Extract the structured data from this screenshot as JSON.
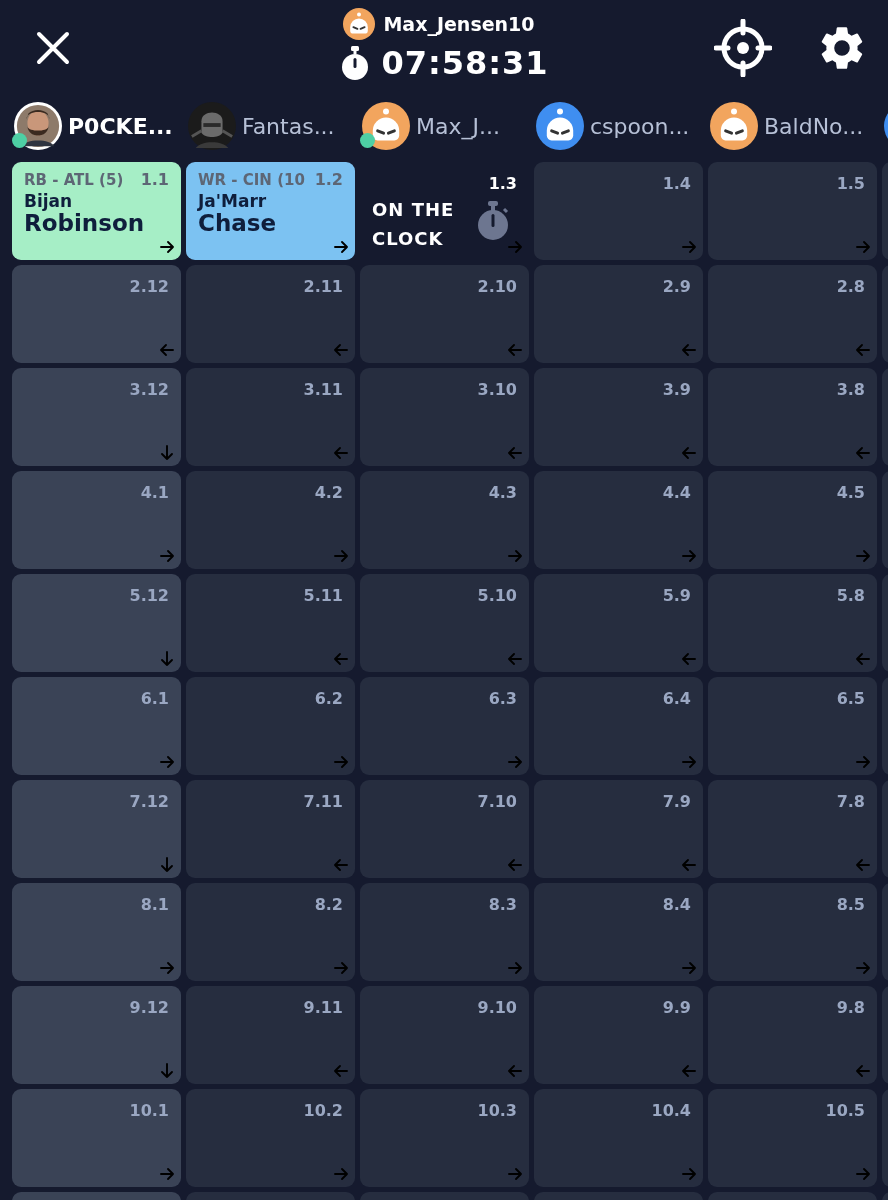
{
  "header": {
    "user": {
      "name": "Max_Jensen10",
      "avatar": {
        "kind": "bot",
        "color": "#f2a55e"
      }
    },
    "timer": "07:58:31"
  },
  "teams": [
    {
      "name": "P0CKE...",
      "selected": true,
      "online": true
    },
    {
      "name": "Fantas...",
      "selected": false,
      "online": false,
      "avatar": {
        "kind": "photo-dark"
      }
    },
    {
      "name": "Max_J...",
      "selected": false,
      "online": true,
      "avatar": {
        "kind": "bot",
        "color": "#f2a55e"
      }
    },
    {
      "name": "cspoon...",
      "selected": false,
      "online": false,
      "avatar": {
        "kind": "bot",
        "color": "#3f8ef0"
      }
    },
    {
      "name": "BaldNo...",
      "selected": false,
      "online": false,
      "avatar": {
        "kind": "bot",
        "color": "#f2a55e"
      }
    }
  ],
  "rounds": [
    {
      "cells": [
        {
          "kind": "player",
          "pick": "1.1",
          "arrow": {
            "kind": "right"
          },
          "position": "RB - ATL (5)",
          "first": "Bijan",
          "last": "Robinson",
          "color": "#a6eec6"
        },
        {
          "kind": "player",
          "pick": "1.2",
          "arrow": {
            "kind": "right"
          },
          "position": "WR - CIN (10",
          "first": "Ja'Marr",
          "last": "Chase",
          "color": "#7cc2f2"
        },
        {
          "kind": "on_clock",
          "pick": "1.3",
          "arrow": {
            "kind": "right"
          },
          "label": "ON THE CLOCK"
        },
        {
          "kind": "empty",
          "pick": "1.4",
          "arrow": {
            "kind": "right"
          }
        },
        {
          "kind": "empty",
          "pick": "1.5",
          "arrow": {
            "kind": "right"
          }
        }
      ]
    },
    {
      "cells": [
        {
          "kind": "empty",
          "pick": "2.12",
          "arrow": {
            "kind": "left"
          }
        },
        {
          "kind": "empty",
          "pick": "2.11",
          "arrow": {
            "kind": "left"
          }
        },
        {
          "kind": "empty",
          "pick": "2.10",
          "arrow": {
            "kind": "left"
          }
        },
        {
          "kind": "empty",
          "pick": "2.9",
          "arrow": {
            "kind": "left"
          }
        },
        {
          "kind": "empty",
          "pick": "2.8",
          "arrow": {
            "kind": "left"
          }
        }
      ]
    },
    {
      "cells": [
        {
          "kind": "empty",
          "pick": "3.12",
          "arrow": {
            "kind": "down"
          }
        },
        {
          "kind": "empty",
          "pick": "3.11",
          "arrow": {
            "kind": "left"
          }
        },
        {
          "kind": "empty",
          "pick": "3.10",
          "arrow": {
            "kind": "left"
          }
        },
        {
          "kind": "empty",
          "pick": "3.9",
          "arrow": {
            "kind": "left"
          }
        },
        {
          "kind": "empty",
          "pick": "3.8",
          "arrow": {
            "kind": "left"
          }
        }
      ]
    },
    {
      "cells": [
        {
          "kind": "empty",
          "pick": "4.1",
          "arrow": {
            "kind": "right"
          }
        },
        {
          "kind": "empty",
          "pick": "4.2",
          "arrow": {
            "kind": "right"
          }
        },
        {
          "kind": "empty",
          "pick": "4.3",
          "arrow": {
            "kind": "right"
          }
        },
        {
          "kind": "empty",
          "pick": "4.4",
          "arrow": {
            "kind": "right"
          }
        },
        {
          "kind": "empty",
          "pick": "4.5",
          "arrow": {
            "kind": "right"
          }
        }
      ]
    },
    {
      "cells": [
        {
          "kind": "empty",
          "pick": "5.12",
          "arrow": {
            "kind": "down"
          }
        },
        {
          "kind": "empty",
          "pick": "5.11",
          "arrow": {
            "kind": "left"
          }
        },
        {
          "kind": "empty",
          "pick": "5.10",
          "arrow": {
            "kind": "left"
          }
        },
        {
          "kind": "empty",
          "pick": "5.9",
          "arrow": {
            "kind": "left"
          }
        },
        {
          "kind": "empty",
          "pick": "5.8",
          "arrow": {
            "kind": "left"
          }
        }
      ]
    },
    {
      "cells": [
        {
          "kind": "empty",
          "pick": "6.1",
          "arrow": {
            "kind": "right"
          }
        },
        {
          "kind": "empty",
          "pick": "6.2",
          "arrow": {
            "kind": "right"
          }
        },
        {
          "kind": "empty",
          "pick": "6.3",
          "arrow": {
            "kind": "right"
          }
        },
        {
          "kind": "empty",
          "pick": "6.4",
          "arrow": {
            "kind": "right"
          }
        },
        {
          "kind": "empty",
          "pick": "6.5",
          "arrow": {
            "kind": "right"
          }
        }
      ]
    },
    {
      "cells": [
        {
          "kind": "empty",
          "pick": "7.12",
          "arrow": {
            "kind": "down"
          }
        },
        {
          "kind": "empty",
          "pick": "7.11",
          "arrow": {
            "kind": "left"
          }
        },
        {
          "kind": "empty",
          "pick": "7.10",
          "arrow": {
            "kind": "left"
          }
        },
        {
          "kind": "empty",
          "pick": "7.9",
          "arrow": {
            "kind": "left"
          }
        },
        {
          "kind": "empty",
          "pick": "7.8",
          "arrow": {
            "kind": "left"
          }
        }
      ]
    },
    {
      "cells": [
        {
          "kind": "empty",
          "pick": "8.1",
          "arrow": {
            "kind": "right"
          }
        },
        {
          "kind": "empty",
          "pick": "8.2",
          "arrow": {
            "kind": "right"
          }
        },
        {
          "kind": "empty",
          "pick": "8.3",
          "arrow": {
            "kind": "right"
          }
        },
        {
          "kind": "empty",
          "pick": "8.4",
          "arrow": {
            "kind": "right"
          }
        },
        {
          "kind": "empty",
          "pick": "8.5",
          "arrow": {
            "kind": "right"
          }
        }
      ]
    },
    {
      "cells": [
        {
          "kind": "empty",
          "pick": "9.12",
          "arrow": {
            "kind": "down"
          }
        },
        {
          "kind": "empty",
          "pick": "9.11",
          "arrow": {
            "kind": "left"
          }
        },
        {
          "kind": "empty",
          "pick": "9.10",
          "arrow": {
            "kind": "left"
          }
        },
        {
          "kind": "empty",
          "pick": "9.9",
          "arrow": {
            "kind": "left"
          }
        },
        {
          "kind": "empty",
          "pick": "9.8",
          "arrow": {
            "kind": "left"
          }
        }
      ]
    },
    {
      "cells": [
        {
          "kind": "empty",
          "pick": "10.1",
          "arrow": {
            "kind": "right"
          }
        },
        {
          "kind": "empty",
          "pick": "10.2",
          "arrow": {
            "kind": "right"
          }
        },
        {
          "kind": "empty",
          "pick": "10.3",
          "arrow": {
            "kind": "right"
          }
        },
        {
          "kind": "empty",
          "pick": "10.4",
          "arrow": {
            "kind": "right"
          }
        },
        {
          "kind": "empty",
          "pick": "10.5",
          "arrow": {
            "kind": "right"
          }
        }
      ]
    }
  ]
}
